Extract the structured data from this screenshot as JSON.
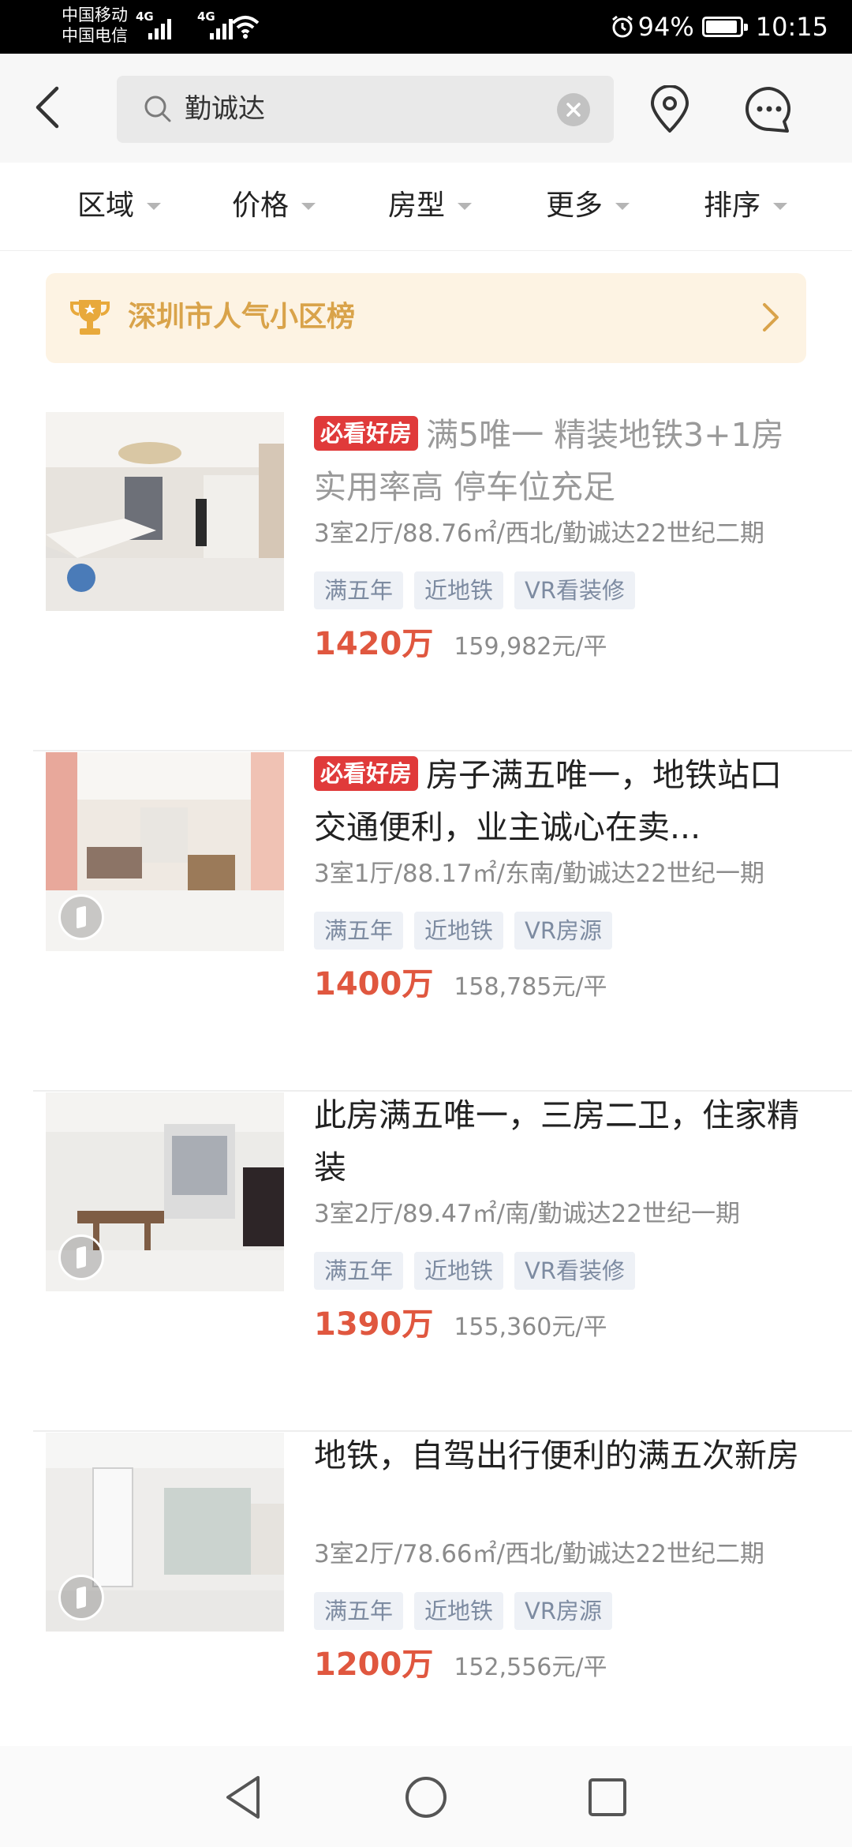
{
  "status_bar": {
    "carrier_1": "中国移动",
    "carrier_2": "中国电信",
    "network_1": "4G",
    "network_2": "4G",
    "battery_text": "94%",
    "battery_level": 0.94,
    "time": "10:15"
  },
  "search": {
    "query": "勤诚达",
    "icons": {
      "back": "chevron-left-icon",
      "search": "search-icon",
      "clear": "clear-icon",
      "location": "location-pin-icon",
      "messages": "chat-bubble-icon"
    }
  },
  "filters": [
    "区域",
    "价格",
    "房型",
    "更多",
    "排序"
  ],
  "ranking_banner": {
    "text": "深圳市人气小区榜",
    "icon": "trophy-icon",
    "text_color": "#d9a34a",
    "background": "#fdf3e3"
  },
  "listings": [
    {
      "badge": "必看好房",
      "title": "满5唯一  精装地铁3+1房 实用率高 停车位充足",
      "title_visited": true,
      "spec": "3室2厅/88.76㎡/西北/勤诚达22世纪二期",
      "tags": [
        "满五年",
        "近地铁",
        "VR看装修"
      ],
      "price": "1420万",
      "unit_price": "159,982元/平",
      "has_vr": false
    },
    {
      "badge": "必看好房",
      "title": "房子满五唯一，地铁站口交通便利，业主诚心在卖...",
      "title_visited": false,
      "spec": "3室1厅/88.17㎡/东南/勤诚达22世纪一期",
      "tags": [
        "满五年",
        "近地铁",
        "VR房源"
      ],
      "price": "1400万",
      "unit_price": "158,785元/平",
      "has_vr": true
    },
    {
      "badge": "",
      "title": "此房满五唯一，三房二卫，住家精装",
      "title_visited": false,
      "spec": "3室2厅/89.47㎡/南/勤诚达22世纪一期",
      "tags": [
        "满五年",
        "近地铁",
        "VR看装修"
      ],
      "price": "1390万",
      "unit_price": "155,360元/平",
      "has_vr": true
    },
    {
      "badge": "",
      "title": "地铁，自驾出行便利的满五次新房",
      "title_visited": false,
      "spec": "3室2厅/78.66㎡/西北/勤诚达22世纪二期",
      "tags": [
        "满五年",
        "近地铁",
        "VR房源"
      ],
      "price": "1200万",
      "unit_price": "152,556元/平",
      "has_vr": true
    }
  ],
  "nav_bar": {
    "icons": [
      "back-triangle-icon",
      "home-circle-icon",
      "recents-square-icon"
    ]
  },
  "colors": {
    "accent_red": "#e03a3a",
    "price_red": "#e0573f",
    "tag_bg": "#eef1f6",
    "tag_text": "#7d8ba1"
  }
}
